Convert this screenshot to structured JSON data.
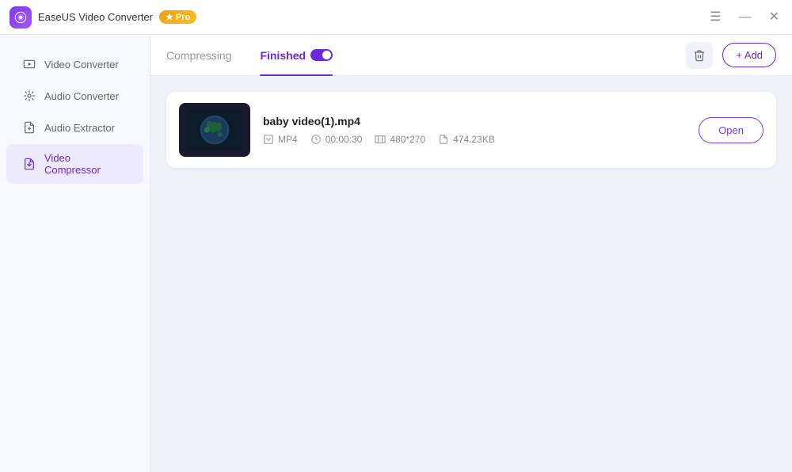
{
  "app": {
    "name": "EaseUS Video Converter",
    "logo_char": "▶",
    "pro_label": "Pro",
    "pro_star": "★"
  },
  "titlebar": {
    "menu_icon": "☰",
    "minimize_icon": "—",
    "close_icon": "✕"
  },
  "sidebar": {
    "items": [
      {
        "id": "video-converter",
        "label": "Video Converter",
        "active": false
      },
      {
        "id": "audio-converter",
        "label": "Audio Converter",
        "active": false
      },
      {
        "id": "audio-extractor",
        "label": "Audio Extractor",
        "active": false
      },
      {
        "id": "video-compressor",
        "label": "Video Compressor",
        "active": true
      }
    ]
  },
  "tabs": {
    "compressing_label": "Compressing",
    "finished_label": "Finished",
    "active": "finished"
  },
  "actions": {
    "delete_title": "Delete",
    "add_label": "+ Add"
  },
  "video": {
    "filename": "baby video(1).mp4",
    "format": "MP4",
    "duration": "00:00:30",
    "resolution": "480*270",
    "filesize": "474.23KB",
    "open_label": "Open"
  }
}
